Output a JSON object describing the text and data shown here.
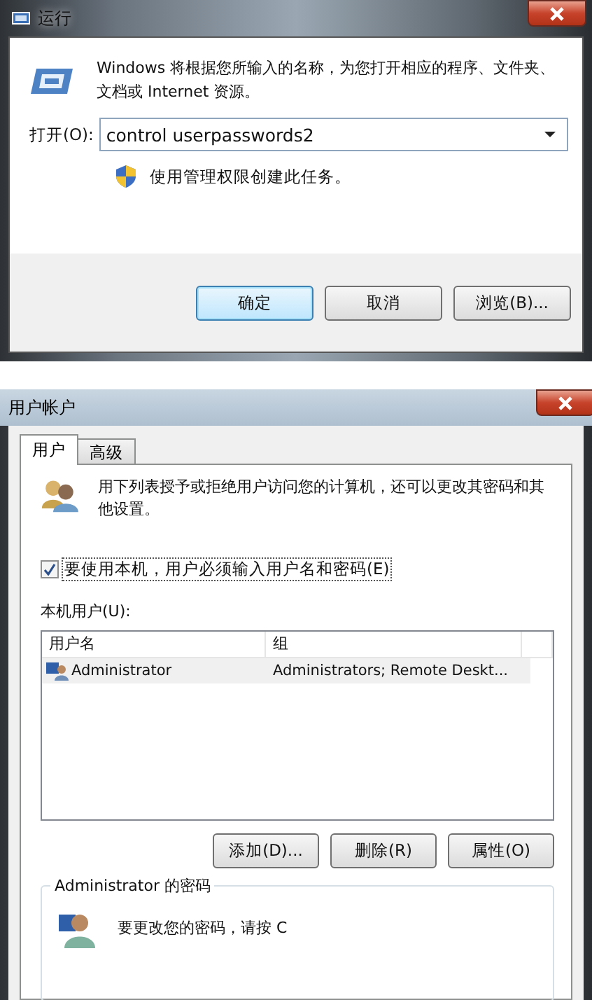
{
  "run_dialog": {
    "title": "运行",
    "description": "Windows 将根据您所输入的名称，为您打开相应的程序、文件夹、文档或 Internet 资源。",
    "open_label": "打开(O):",
    "command": "control userpasswords2",
    "admin_note": "使用管理权限创建此任务。",
    "buttons": [
      {
        "label": "确定",
        "default": true
      },
      {
        "label": "取消",
        "default": false
      },
      {
        "label": "浏览(B)...",
        "default": false
      }
    ]
  },
  "user_accounts": {
    "title": "用户帐户",
    "tabs": [
      {
        "label": "用户",
        "selected": true
      },
      {
        "label": "高级",
        "selected": false
      }
    ],
    "intro": "用下列表授予或拒绝用户访问您的计算机，还可以更改其密码和其他设置。",
    "require_password": {
      "label": "要使用本机，用户必须输入用户名和密码(E)",
      "checked": true
    },
    "users_label": "本机用户(U):",
    "table": {
      "columns": [
        "用户名",
        "组"
      ],
      "rows": [
        {
          "name": "Administrator",
          "group": "Administrators; Remote Deskt...",
          "selected": true
        }
      ]
    },
    "buttons": [
      "添加(D)...",
      "删除(R)",
      "属性(O)"
    ],
    "password_group": {
      "title": "Administrator 的密码",
      "text": "要更改您的密码，请按 C"
    }
  }
}
